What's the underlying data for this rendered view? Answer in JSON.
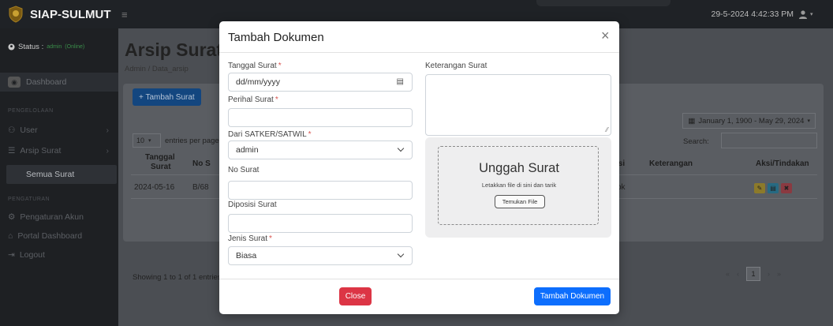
{
  "app": {
    "title": "SIAP-SULMUT",
    "menu_icon": "≡",
    "datetime": "29-5-2024 4:42:33 PM"
  },
  "sidebar": {
    "status_label": "Status :",
    "status_user": "admin",
    "status_online": "(Online)",
    "dashboard": "Dashboard",
    "heading_pengelolaan": "PENGELOLAAN",
    "user": "User",
    "arsip_surat": "Arsip Surat",
    "semua_surat": "Semua Surat",
    "heading_pengaturan": "PENGATURAN",
    "pengaturan_akun": "Pengaturan Akun",
    "portal_dashboard": "Portal Dashboard",
    "logout": "Logout"
  },
  "page": {
    "title": "Arsip Surat",
    "breadcrumb": "Admin / Data_arsip",
    "add_button": "+ Tambah Surat",
    "entries_value": "10",
    "entries_label": "entries per page",
    "date_range": "January 1, 1900 - May 29, 2024",
    "search_label": "Search:",
    "table": {
      "headers": {
        "tanggal_line1": "Tanggal",
        "tanggal_line2": "Surat",
        "no_surat": "No S",
        "disposisi": "isi",
        "keterangan": "Keterangan",
        "aksi": "Aksi/Tindakan"
      },
      "row": {
        "tanggal": "2024-05-16",
        "no": "B/68",
        "disposisi": "ok"
      }
    },
    "showing": "Showing 1 to 1 of 1 entries",
    "pager": {
      "first": "«",
      "prev": "‹",
      "current": "1",
      "next": "›",
      "last": "»"
    }
  },
  "modal": {
    "title": "Tambah Dokumen",
    "close_icon": "×",
    "tanggal_label": "Tanggal Surat",
    "tanggal_placeholder": "dd/mm/yyyy",
    "perihal_label": "Perihal Surat",
    "dari_label": "Dari SATKER/SATWIL",
    "dari_value": "admin",
    "no_label": "No Surat",
    "disposisi_label": "Diposisi Surat",
    "jenis_label": "Jenis Surat",
    "jenis_value": "Biasa",
    "keterangan_label": "Keterangan Surat",
    "required_mark": "*",
    "upload": {
      "title": "Unggah Surat",
      "subtitle": "Letakkan file di sini dan tarik",
      "button": "Temukan File"
    },
    "close_button": "Close",
    "submit_button": "Tambah Dokumen"
  },
  "colors": {
    "primary": "#0d6efd",
    "danger": "#dc3545",
    "action_edit": "#b59a1a",
    "action_view": "#1d7ea0",
    "action_delete": "#a5323c"
  }
}
